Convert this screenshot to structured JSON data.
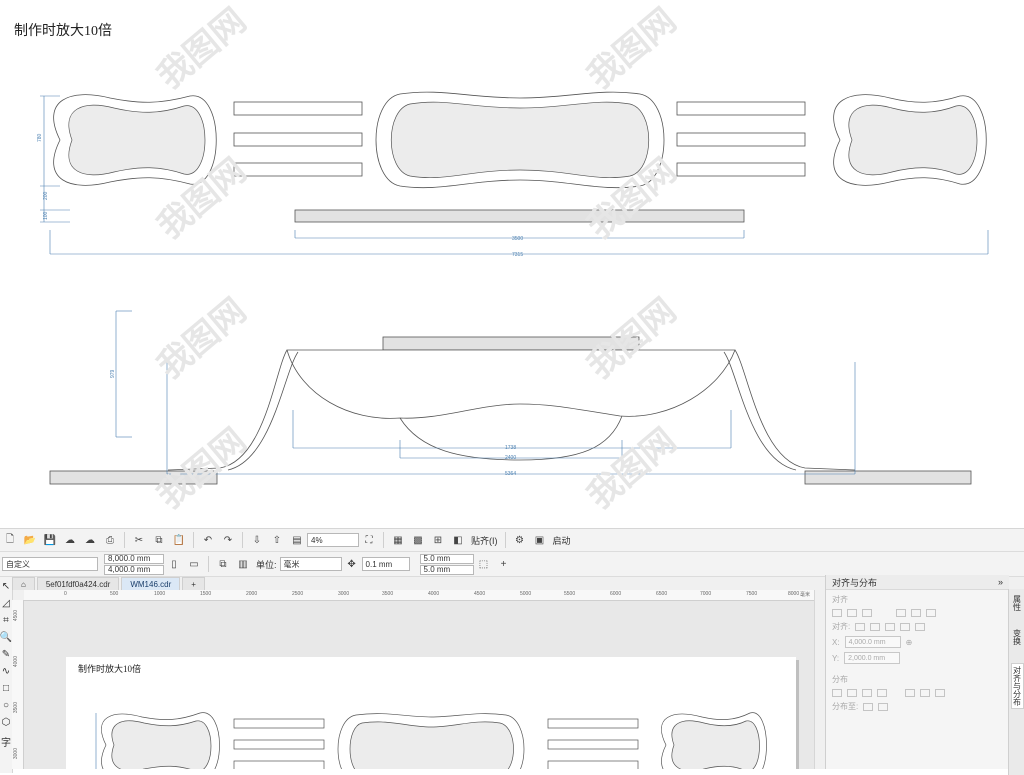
{
  "drawing": {
    "title": "制作时放大10倍",
    "dims_top": {
      "height_left": "780",
      "d200": "200",
      "d100": "100",
      "inner_width": "3500",
      "total_width": "7315"
    },
    "dims_bottom": {
      "height": "979",
      "d1738": "1738",
      "d2400": "2400",
      "d5364": "5364"
    },
    "watermark": "我图网"
  },
  "app": {
    "toolbar1": {
      "zoom_value": "4%",
      "snap_label": "贴齐(I)",
      "launch_label": "启动"
    },
    "toolbar2": {
      "preset_value": "自定义",
      "width_value": "8,000.0 mm",
      "height_value": "4,000.0 mm",
      "units_label": "单位:",
      "units_value": "毫米",
      "nudge_value": "0.1 mm",
      "dup_x_value": "5.0 mm",
      "dup_y_value": "5.0 mm"
    },
    "tabs": [
      {
        "label": "5ef01fdf0a424.cdr"
      },
      {
        "label": "WM146.cdr"
      }
    ],
    "ruler_h": [
      "0",
      "500",
      "1000",
      "1500",
      "2000",
      "2500",
      "3000",
      "3500",
      "4000",
      "4500",
      "5000",
      "5500",
      "6000",
      "6500",
      "7000",
      "7500",
      "8000"
    ],
    "ruler_h_unit": "毫米",
    "ruler_v": [
      "4500",
      "4000",
      "3500",
      "3000"
    ],
    "page_title": "制作时放大10倍",
    "panel": {
      "title": "对齐与分布",
      "align_section": "对齐",
      "align_to_label": "对齐:",
      "x_label": "X:",
      "x_value": "4,000.0 mm",
      "y_label": "Y:",
      "y_value": "2,000.0 mm",
      "distribute_section": "分布",
      "distribute_to_label": "分布至:"
    },
    "side_tabs": [
      "属性",
      "变换",
      "对齐与分布"
    ]
  }
}
